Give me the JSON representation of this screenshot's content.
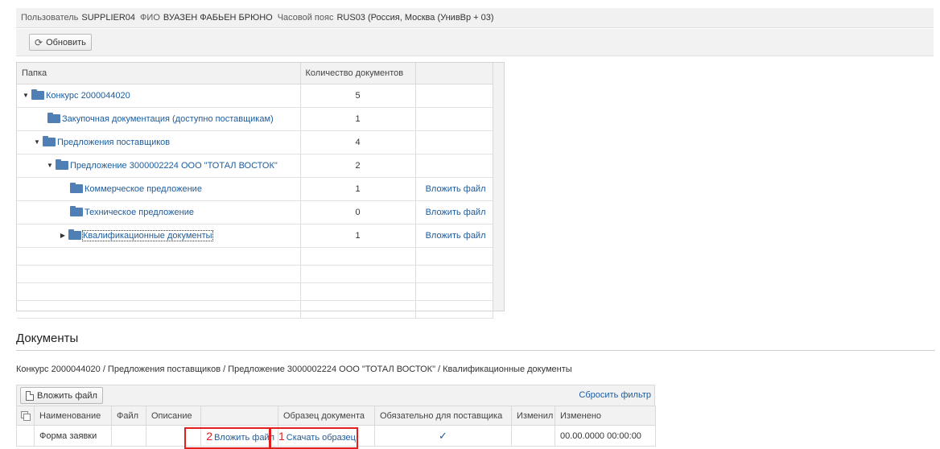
{
  "header": {
    "user_label": "Пользователь",
    "user_value": "SUPPLIER04",
    "fio_label": "ФИО",
    "fio_value": "ВУАЗЕН ФАБЬЕН БРЮНО",
    "tz_label": "Часовой пояс",
    "tz_value": "RUS03 (Россия, Москва (УнивВр + 03)"
  },
  "toolbar": {
    "refresh_label": "Обновить",
    "refresh_icon": "refresh-icon"
  },
  "tree": {
    "columns": [
      "Папка",
      "Количество документов",
      ""
    ],
    "rows": [
      {
        "label": "Конкурс 2000044020",
        "count": "5",
        "action": ""
      },
      {
        "label": "Закупочная документация (доступно поставщикам)",
        "count": "1",
        "action": ""
      },
      {
        "label": "Предложения поставщиков",
        "count": "4",
        "action": ""
      },
      {
        "label": "Предложение 3000002224 ООО \"ТОТАЛ ВОСТОК\"",
        "count": "2",
        "action": ""
      },
      {
        "label": "Коммерческое предложение",
        "count": "1",
        "action": "Вложить файл"
      },
      {
        "label": "Техническое предложение",
        "count": "0",
        "action": "Вложить файл"
      },
      {
        "label": "Квалификационные документы",
        "count": "1",
        "action": "Вложить файл"
      }
    ]
  },
  "documents": {
    "title": "Документы",
    "breadcrumb": "Конкурс 2000044020 / Предложения поставщиков / Предложение 3000002224 ООО \"ТОТАЛ ВОСТОК\" / Квалификационные документы",
    "attach_label": "Вложить файл",
    "reset_filter": "Сбросить фильтр",
    "columns": [
      "Наименование",
      "Файл",
      "Описание",
      "",
      "Образец документа",
      "Обязательно для поставщика",
      "Изменил",
      "Изменено"
    ],
    "row": {
      "name": "Форма заявки",
      "file": "",
      "description": "",
      "attach_link": "Вложить файл",
      "attach_marker": "2",
      "sample_link": "Скачать образец",
      "sample_marker": "1",
      "mandatory": "✓",
      "changed_by": "",
      "changed_at": "00.00.0000 00:00:00"
    }
  },
  "colors": {
    "link": "#1d5b9c",
    "highlight": "#e0201f",
    "folder": "#4f7fb5"
  }
}
